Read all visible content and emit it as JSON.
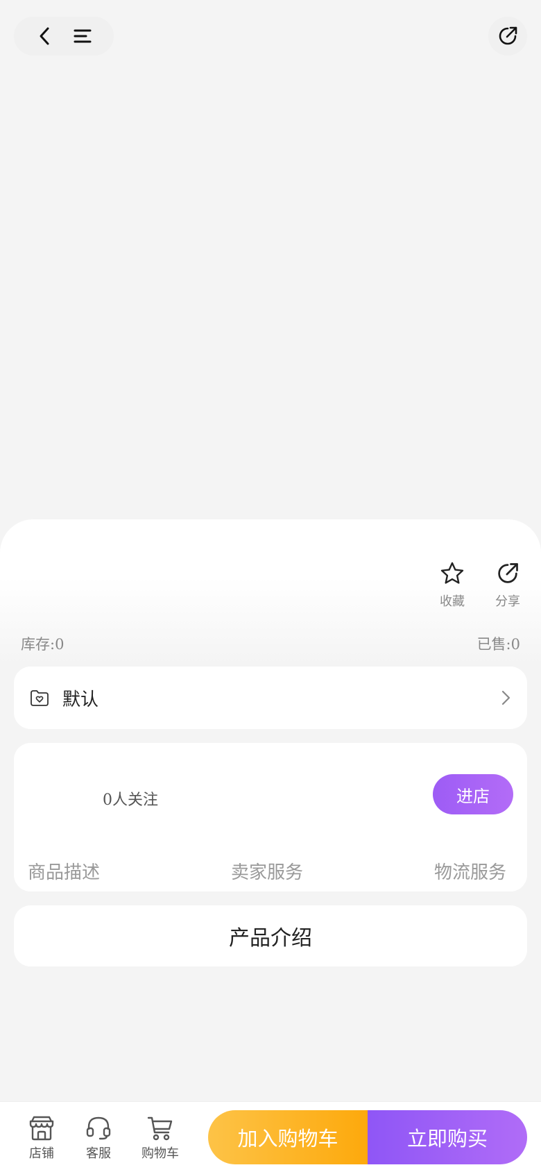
{
  "header": {
    "back_icon": "chevron-left-icon",
    "menu_icon": "menu-icon",
    "share_icon": "share-icon"
  },
  "product": {
    "actions": [
      {
        "label": "收藏",
        "icon": "star-icon"
      },
      {
        "label": "分享",
        "icon": "share-icon"
      }
    ],
    "stock_text": "库存:0",
    "sold_text": "已售:0"
  },
  "spec": {
    "label": "默认",
    "icon": "folder-heart-icon"
  },
  "shop": {
    "followers_text": "0人关注",
    "enter_label": "进店",
    "ratings": [
      "商品描述",
      "卖家服务",
      "物流服务"
    ]
  },
  "intro": {
    "title": "产品介绍"
  },
  "bottom_bar": {
    "items": [
      {
        "label": "店铺",
        "icon": "store-icon"
      },
      {
        "label": "客服",
        "icon": "headset-icon"
      },
      {
        "label": "购物车",
        "icon": "cart-icon"
      }
    ],
    "add_to_cart_label": "加入购物车",
    "buy_now_label": "立即购买"
  },
  "colors": {
    "background": "#f4f4f4",
    "accent_purple": "#a064f6",
    "accent_orange": "#fdb22a"
  }
}
